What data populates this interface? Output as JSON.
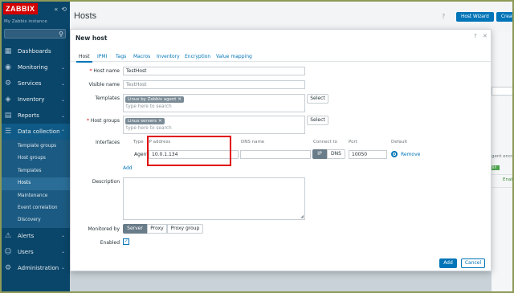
{
  "sidebar": {
    "logo": "ZABBIX",
    "instance": "My Zabbix instance",
    "menu": [
      {
        "label": "Dashboards",
        "icon": "dashboard-icon"
      },
      {
        "label": "Monitoring",
        "icon": "monitoring-icon"
      },
      {
        "label": "Services",
        "icon": "services-icon"
      },
      {
        "label": "Inventory",
        "icon": "inventory-icon"
      },
      {
        "label": "Reports",
        "icon": "reports-icon"
      },
      {
        "label": "Data collection",
        "icon": "data-collection-icon"
      },
      {
        "label": "Alerts",
        "icon": "alerts-icon"
      },
      {
        "label": "Users",
        "icon": "users-icon"
      },
      {
        "label": "Administration",
        "icon": "administration-icon"
      }
    ],
    "submenu": [
      "Template groups",
      "Host groups",
      "Templates",
      "Hosts",
      "Maintenance",
      "Event correlation",
      "Discovery"
    ],
    "active_submenu": "Hosts"
  },
  "header": {
    "title": "Hosts",
    "help": "?",
    "host_wizard": "Host Wizard",
    "create_host": "Create host"
  },
  "background": {
    "frag_agent_encr": "gent encry",
    "frag_status": "Enab",
    "frag_avail": "ZBX",
    "frag_row": "Enab"
  },
  "modal": {
    "title": "New host",
    "help": "?",
    "close": "✕",
    "tabs": [
      "Host",
      "IPMI",
      "Tags",
      "Macros",
      "Inventory",
      "Encryption",
      "Value mapping"
    ],
    "active_tab": "Host",
    "host_name": {
      "label": "Host name",
      "value": "TestHost"
    },
    "visible_name": {
      "label": "Visible name",
      "placeholder": "TestHost"
    },
    "templates": {
      "label": "Templates",
      "chip": "Linux by Zabbix agent",
      "placeholder": "type here to search",
      "select": "Select"
    },
    "host_groups": {
      "label": "Host groups",
      "chip": "Linux servers",
      "placeholder": "type here to search",
      "select": "Select"
    },
    "interfaces": {
      "label": "Interfaces",
      "headers": {
        "type": "Type",
        "ip": "IP address",
        "dns": "DNS name",
        "connect": "Connect to",
        "port": "Port",
        "default": "Default"
      },
      "row": {
        "type": "Agent",
        "ip": "10.0.1.134",
        "dns": "",
        "ip_btn": "IP",
        "dns_btn": "DNS",
        "port": "10050",
        "remove": "Remove"
      },
      "add": "Add"
    },
    "description": {
      "label": "Description",
      "value": ""
    },
    "monitored_by": {
      "label": "Monitored by",
      "options": [
        "Server",
        "Proxy",
        "Proxy group"
      ],
      "selected": "Server"
    },
    "enabled": {
      "label": "Enabled",
      "checked": true
    },
    "buttons": {
      "add": "Add",
      "cancel": "Cancel"
    }
  },
  "colors": {
    "sidebar": "#0a466a",
    "accent": "#0275b8",
    "logo": "#d40000",
    "highlight": "#e00000"
  }
}
